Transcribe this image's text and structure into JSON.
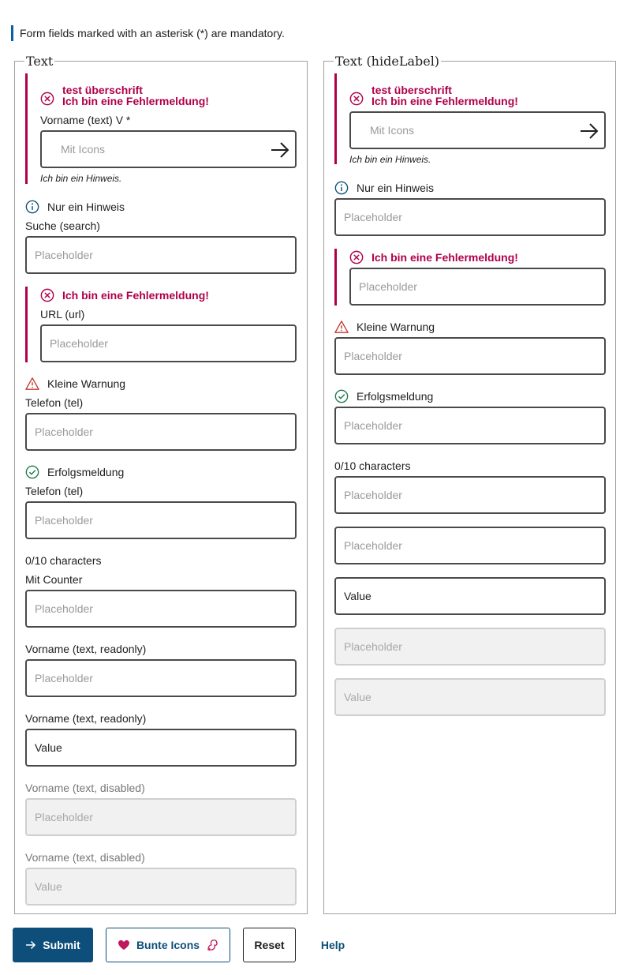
{
  "notice": "Form fields marked with an asterisk (*) are mandatory.",
  "colors": {
    "error": "#b0004a",
    "info": "#0d4f7a",
    "warning": "#c0392b",
    "success": "#1f7a4c",
    "primary": "#0d4f7a"
  },
  "left": {
    "legend": "Text",
    "f1": {
      "error_title": "test überschrift",
      "error_msg": "Ich bin eine Fehlermeldung!",
      "label": "Vorname (text) V *",
      "placeholder": "Mit Icons",
      "hint": "Ich bin ein Hinweis."
    },
    "f2": {
      "info": "Nur ein Hinweis",
      "label": "Suche (search)",
      "placeholder": "Placeholder"
    },
    "f3": {
      "error_msg": "Ich bin eine Fehlermeldung!",
      "label": "URL (url)",
      "placeholder": "Placeholder"
    },
    "f4": {
      "warning": "Kleine Warnung",
      "label": "Telefon (tel)",
      "placeholder": "Placeholder"
    },
    "f5": {
      "success": "Erfolgsmeldung",
      "label": "Telefon (tel)",
      "placeholder": "Placeholder"
    },
    "f6": {
      "counter": "0/10 characters",
      "label": "Mit Counter",
      "placeholder": "Placeholder"
    },
    "f7": {
      "label": "Vorname (text, readonly)",
      "placeholder": "Placeholder"
    },
    "f8": {
      "label": "Vorname (text, readonly)",
      "value": "Value"
    },
    "f9": {
      "label": "Vorname (text, disabled)",
      "placeholder": "Placeholder"
    },
    "f10": {
      "label": "Vorname (text, disabled)",
      "value": "Value"
    }
  },
  "right": {
    "legend": "Text (hideLabel)",
    "f1": {
      "error_title": "test überschrift",
      "error_msg": "Ich bin eine Fehlermeldung!",
      "placeholder": "Mit Icons",
      "hint": "Ich bin ein Hinweis."
    },
    "f2": {
      "info": "Nur ein Hinweis",
      "placeholder": "Placeholder"
    },
    "f3": {
      "error_msg": "Ich bin eine Fehlermeldung!",
      "placeholder": "Placeholder"
    },
    "f4": {
      "warning": "Kleine Warnung",
      "placeholder": "Placeholder"
    },
    "f5": {
      "success": "Erfolgsmeldung",
      "placeholder": "Placeholder"
    },
    "f6": {
      "counter": "0/10 characters",
      "placeholder": "Placeholder"
    },
    "f7": {
      "placeholder": "Placeholder"
    },
    "f8": {
      "value": "Value"
    },
    "f9": {
      "placeholder": "Placeholder"
    },
    "f10": {
      "value": "Value"
    }
  },
  "buttons": {
    "submit": "Submit",
    "bunte": "Bunte Icons",
    "reset": "Reset",
    "help": "Help"
  },
  "icons": {
    "error": "circle-x-icon",
    "info": "info-circle-icon",
    "warning": "warning-triangle-icon",
    "success": "check-circle-icon",
    "arrow": "arrow-right-icon",
    "heart": "heart-icon",
    "squirrel": "squirrel-icon"
  }
}
